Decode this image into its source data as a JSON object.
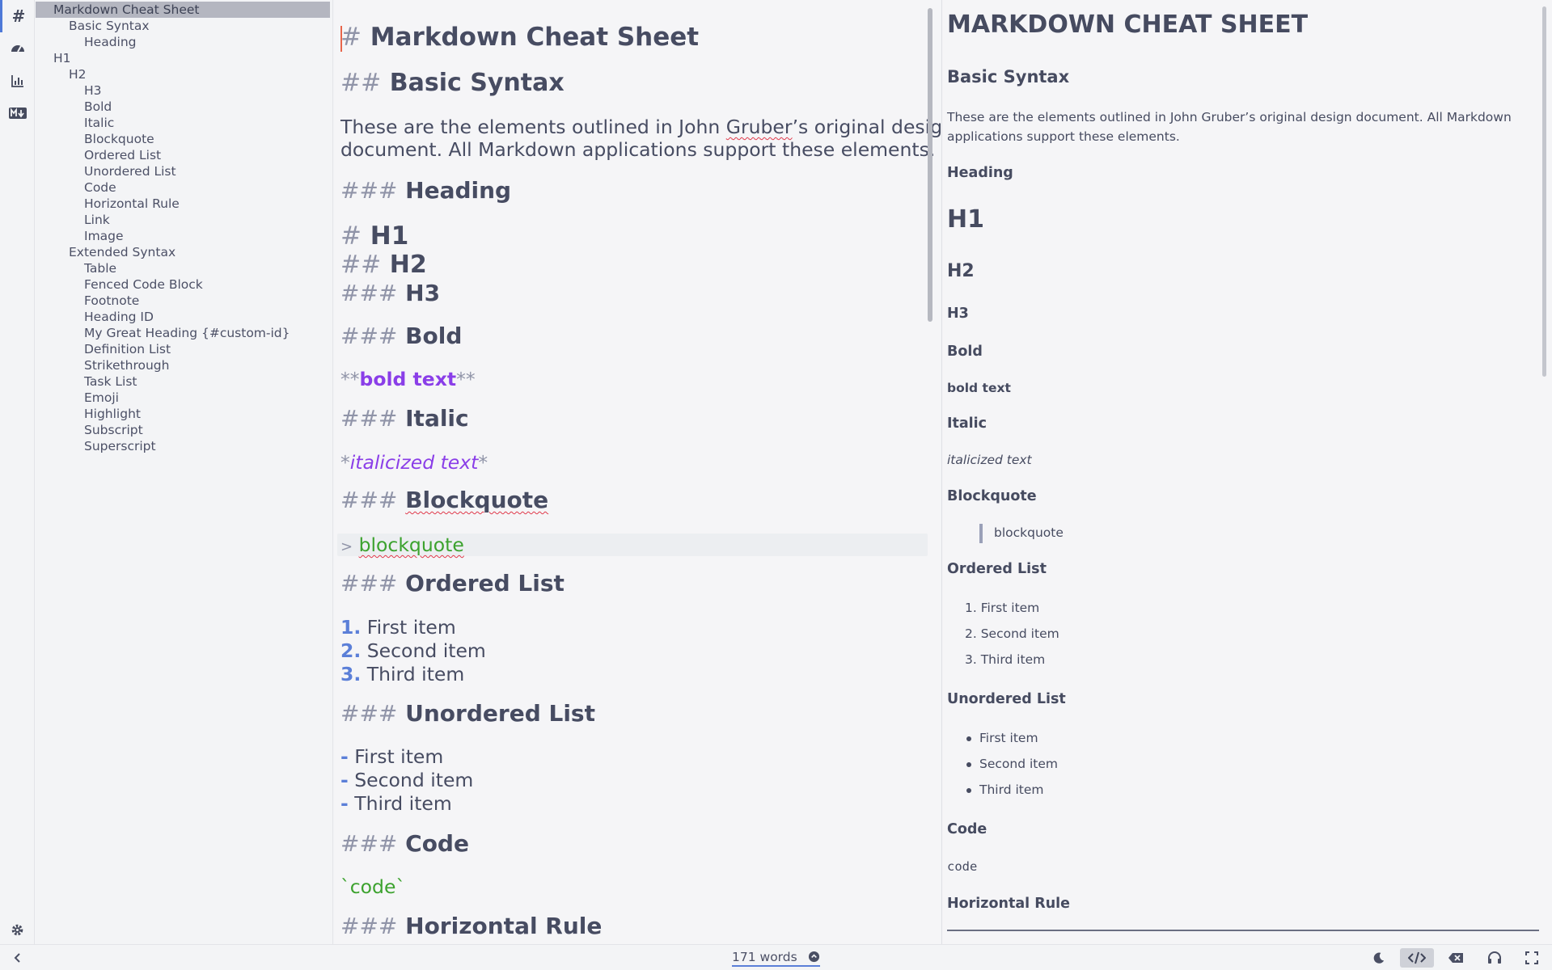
{
  "rail": {
    "items": [
      {
        "icon": "hash-icon",
        "glyph": "#"
      },
      {
        "icon": "dashboard-icon"
      },
      {
        "icon": "bar-chart-icon"
      },
      {
        "icon": "markdown-icon"
      }
    ]
  },
  "toc": [
    {
      "label": "Markdown Cheat Sheet",
      "level": 0,
      "selected": true
    },
    {
      "label": "Basic Syntax",
      "level": 1
    },
    {
      "label": "Heading",
      "level": 2
    },
    {
      "label": "H1",
      "level": 0
    },
    {
      "label": "H2",
      "level": 1
    },
    {
      "label": "H3",
      "level": 2
    },
    {
      "label": "Bold",
      "level": 2
    },
    {
      "label": "Italic",
      "level": 2
    },
    {
      "label": "Blockquote",
      "level": 2
    },
    {
      "label": "Ordered List",
      "level": 2
    },
    {
      "label": "Unordered List",
      "level": 2
    },
    {
      "label": "Code",
      "level": 2
    },
    {
      "label": "Horizontal Rule",
      "level": 2
    },
    {
      "label": "Link",
      "level": 2
    },
    {
      "label": "Image",
      "level": 2
    },
    {
      "label": "Extended Syntax",
      "level": 1
    },
    {
      "label": "Table",
      "level": 2
    },
    {
      "label": "Fenced Code Block",
      "level": 2
    },
    {
      "label": "Footnote",
      "level": 2
    },
    {
      "label": "Heading ID",
      "level": 2
    },
    {
      "label": "My Great Heading {#custom-id}",
      "level": 2
    },
    {
      "label": "Definition List",
      "level": 2
    },
    {
      "label": "Strikethrough",
      "level": 2
    },
    {
      "label": "Task List",
      "level": 2
    },
    {
      "label": "Emoji",
      "level": 2
    },
    {
      "label": "Highlight",
      "level": 2
    },
    {
      "label": "Subscript",
      "level": 2
    },
    {
      "label": "Superscript",
      "level": 2
    }
  ],
  "editor": {
    "title_mark": "#",
    "title": "Markdown Cheat Sheet",
    "basic_mark": "##",
    "basic": "Basic Syntax",
    "intro_line1_a": "These are the elements outlined in John ",
    "intro_line1_b": "Gruber",
    "intro_line1_c": "’s original design",
    "intro_line2": "document. All Markdown applications support these elements.",
    "h3_mark": "###",
    "heading": "Heading",
    "h1_mark": "#",
    "h1": "H1",
    "h2_mark": "##",
    "h2": "H2",
    "h3": "H3",
    "bold_heading": "Bold",
    "bold_mark": "**",
    "bold_text": "bold text",
    "italic_heading": "Italic",
    "italic_mark": "*",
    "italic_text": "italicized text",
    "blockquote_heading": "Blockquote",
    "quote_mark": ">",
    "quote_text": "blockquote",
    "ordered_heading": "Ordered List",
    "ordered": [
      {
        "num": "1.",
        "text": "First item"
      },
      {
        "num": "2.",
        "text": "Second item"
      },
      {
        "num": "3.",
        "text": "Third item"
      }
    ],
    "unordered_heading": "Unordered List",
    "bullet_mark": "-",
    "unordered": [
      "First item",
      "Second item",
      "Third item"
    ],
    "code_heading": "Code",
    "tick": "`",
    "code_text": "code",
    "hr_heading": "Horizontal Rule"
  },
  "preview": {
    "title": "MARKDOWN CHEAT SHEET",
    "basic": "Basic Syntax",
    "intro": "These are the elements outlined in John Gruber’s original design document. All Markdown applications support these elements.",
    "heading": "Heading",
    "h1": "H1",
    "h2": "H2",
    "h3": "H3",
    "bold_heading": "Bold",
    "bold_text": "bold text",
    "italic_heading": "Italic",
    "italic_text": "italicized text",
    "blockquote_heading": "Blockquote",
    "quote_text": "blockquote",
    "ordered_heading": "Ordered List",
    "ordered": [
      "1. First item",
      "2. Second item",
      "3. Third item"
    ],
    "unordered_heading": "Unordered List",
    "unordered": [
      "First item",
      "Second item",
      "Third item"
    ],
    "code_heading": "Code",
    "code_text": "code",
    "hr_heading": "Horizontal Rule"
  },
  "status": {
    "word_count": "171 words",
    "buttons": [
      "collapse-left-icon",
      "moon-icon",
      "code-view-icon",
      "clear-icon",
      "headphones-icon",
      "fullscreen-icon"
    ]
  },
  "colors": {
    "accent": "#5b7fd8",
    "bold_purple": "#8a3ee8",
    "code_green": "#3ca22e",
    "cursor": "#e8654a"
  }
}
